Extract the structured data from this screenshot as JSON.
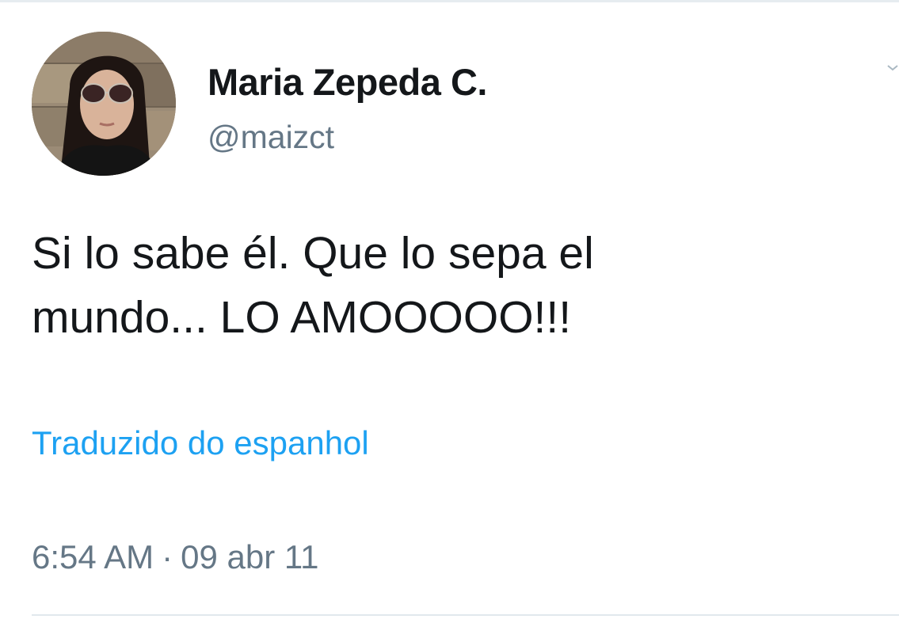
{
  "tweet": {
    "author": {
      "display_name": "Maria Zepeda C.",
      "handle": "@maizct",
      "avatar_icon": "profile-photo"
    },
    "text_line_1": "Si lo sabe él. Que lo sepa el",
    "text_line_2": "mundo... LO AMOOOOO!!!",
    "translate_label": "Traduzido do espanhol",
    "time": "6:54 AM",
    "separator": "·",
    "date": "09 abr 11",
    "more_icon": "chevron-down-icon"
  },
  "colors": {
    "text_primary": "#14171a",
    "text_secondary": "#657786",
    "link": "#1da1f2",
    "divider": "#e1e8ed"
  }
}
